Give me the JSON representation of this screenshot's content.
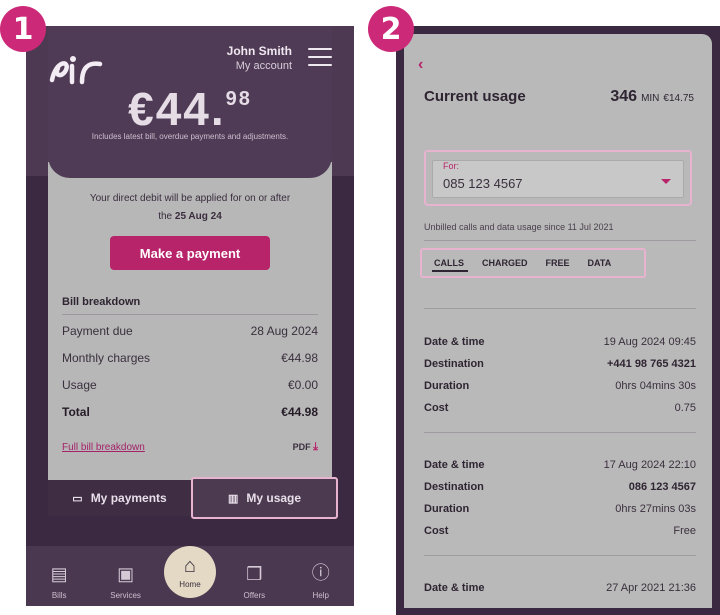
{
  "steps": [
    "1",
    "2"
  ],
  "screen1": {
    "user_name": "John Smith",
    "user_sub": "My account",
    "amount_main": "€44.",
    "amount_cents": "98",
    "includes": "Includes latest bill, overdue payments and adjustments.",
    "direct_debit_line1": "Your direct debit will be applied for on or after",
    "direct_debit_the": "the",
    "direct_debit_date": "25 Aug 24",
    "pay_button": "Make a payment",
    "bill_title": "Bill breakdown",
    "bill_rows": [
      {
        "label": "Payment due",
        "value": "28 Aug 2024"
      },
      {
        "label": "Monthly charges",
        "value": "€44.98"
      },
      {
        "label": "Usage",
        "value": "€0.00"
      },
      {
        "label": "Total",
        "value": "€44.98"
      }
    ],
    "full_bill_link": "Full bill breakdown",
    "pdf_label": "PDF",
    "tabs": [
      {
        "label": "My payments",
        "icon": "card-icon"
      },
      {
        "label": "My usage",
        "icon": "bar-chart-icon"
      }
    ],
    "nav": [
      {
        "label": "Bills",
        "icon": "bills-icon"
      },
      {
        "label": "Services",
        "icon": "services-icon"
      },
      {
        "label": "Home",
        "icon": "home-icon"
      },
      {
        "label": "Offers",
        "icon": "gift-icon"
      },
      {
        "label": "Help",
        "icon": "help-icon"
      }
    ]
  },
  "screen2": {
    "title": "Current usage",
    "minutes": "346",
    "min_label": "MIN",
    "cost": "€14.75",
    "for_label": "For:",
    "phone_number": "085 123 4567",
    "unbilled": "Unbilled calls and data usage since 11 Jul 2021",
    "tabs": [
      "CALLS",
      "CHARGED",
      "FREE",
      "DATA"
    ],
    "calls": [
      {
        "rows": [
          {
            "k": "Date & time",
            "v": "19 Aug 2024   09:45"
          },
          {
            "k": "Destination",
            "v": "+441 98 765 4321"
          },
          {
            "k": "Duration",
            "v": "0hrs  04mins  30s"
          },
          {
            "k": "Cost",
            "v": "0.75"
          }
        ]
      },
      {
        "rows": [
          {
            "k": "Date & time",
            "v": "17 Aug 2024   22:10"
          },
          {
            "k": "Destination",
            "v": "086 123 4567"
          },
          {
            "k": "Duration",
            "v": "0hrs  27mins  03s"
          },
          {
            "k": "Cost",
            "v": "Free"
          }
        ]
      },
      {
        "rows": [
          {
            "k": "Date & time",
            "v": "27 Apr 2021   21:36"
          }
        ]
      }
    ]
  }
}
